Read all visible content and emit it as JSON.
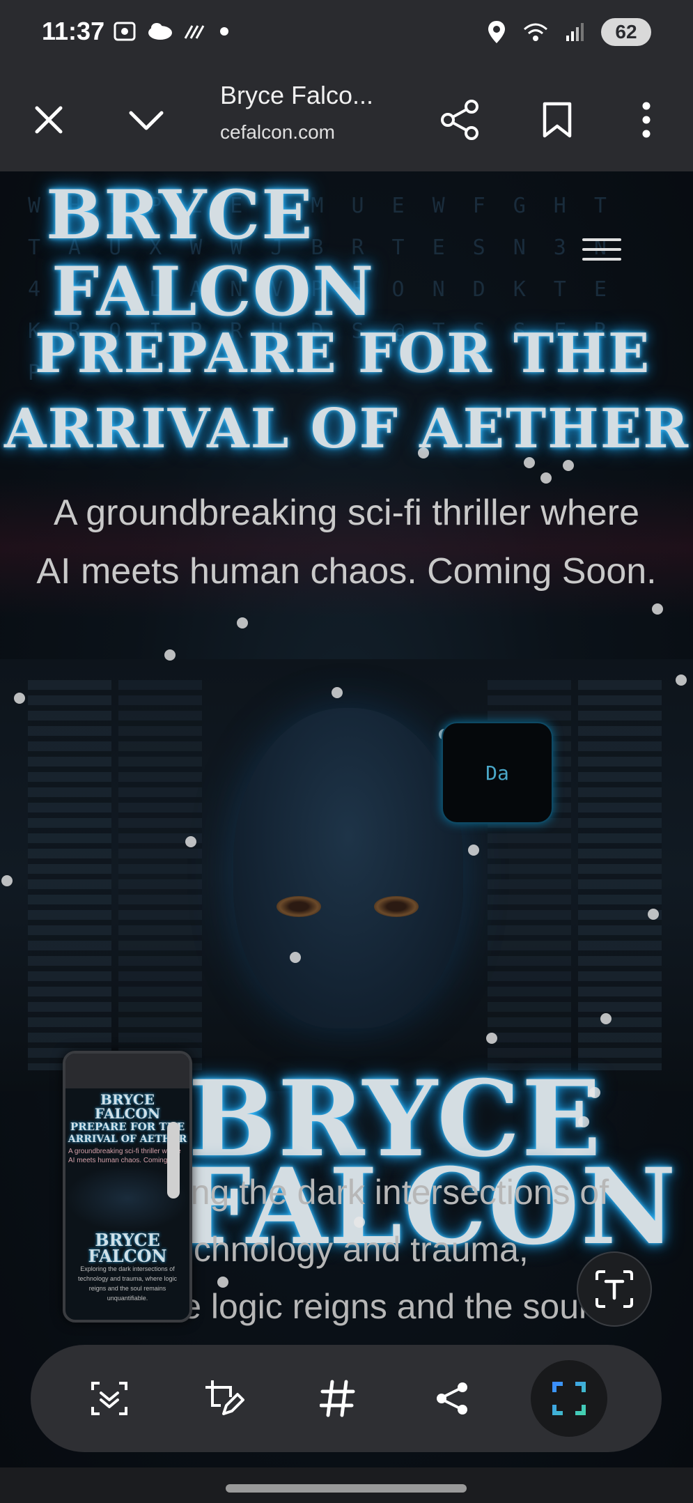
{
  "status_bar": {
    "time": "11:37",
    "battery": "62",
    "icons": [
      "screenshot-icon",
      "cloud-icon",
      "signal-lines-icon",
      "dot-icon",
      "location-icon",
      "wifi-icon",
      "cell-signal-icon",
      "battery-icon"
    ]
  },
  "browser": {
    "title": "Bryce Falco...",
    "url": "cefalcon.com",
    "buttons": [
      "close-icon",
      "chevron-down-icon",
      "share-icon",
      "bookmark-icon",
      "more-vertical-icon"
    ]
  },
  "page": {
    "brand_line1": "BRYCE",
    "brand_line2": "FALCON",
    "headline1": "PREPARE FOR THE",
    "headline2": "ARRIVAL OF AETHER",
    "subtitle1": "A groundbreaking sci-fi thriller where",
    "subtitle2": "AI meets human chaos. Coming Soon.",
    "chat_text": "Da",
    "bottom_brand1": "BRYCE",
    "bottom_brand2": "FALCON",
    "tagline1": "Exploring the dark intersections of",
    "tagline2": "technology and trauma,",
    "tagline3": "where logic reigns and the soul"
  },
  "thumbnail": {
    "brand1": "BRYCE",
    "brand2": "FALCON",
    "headline1": "PREPARE FOR THE",
    "headline2": "ARRIVAL OF AETHER",
    "sub": "A groundbreaking sci-fi thriller where AI meets human chaos. Coming Soon.",
    "bottom1": "BRYCE",
    "bottom2": "FALCON",
    "tagline": "Exploring the dark intersections of technology and trauma, where logic reigns and the soul remains unquantifiable."
  },
  "toolbar": {
    "tools": [
      "scan-icon",
      "edit-crop-icon",
      "hashtag-icon",
      "share-icon",
      "capture-frame-icon"
    ]
  },
  "colors": {
    "glow": "#1e9fe6",
    "accent_gradient": [
      "#3b8cff",
      "#44d1b0"
    ]
  }
}
